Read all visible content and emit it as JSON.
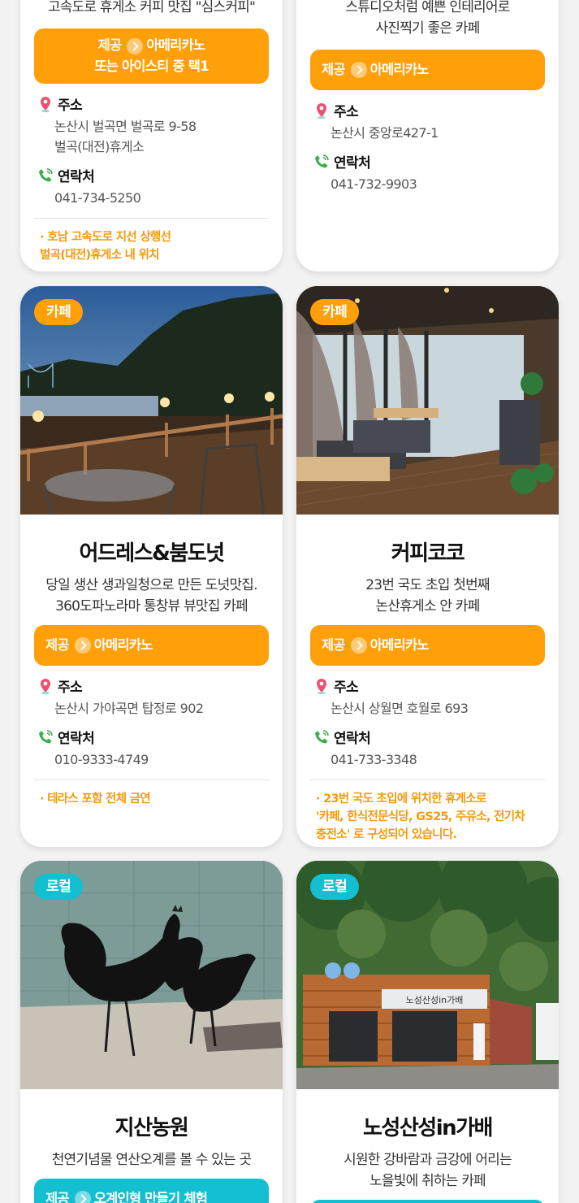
{
  "cards": {
    "c1": {
      "desc_lines": [
        "고속도로 휴게소 커피 맛집 \"심스커피\""
      ],
      "offer_label": "제공",
      "offer_line1": "아메리카노",
      "offer_line2": "또는 아이스티 중 택1",
      "address_label": "주소",
      "address_lines": [
        "논산시 벌곡면 벌곡로 9-58",
        "벌곡(대전)휴게소"
      ],
      "contact_label": "연락처",
      "phone": "041-734-5250",
      "note_lines": [
        "· 호남 고속도로 지선 상행선",
        "벌곡(대전)휴게소 내 위치"
      ]
    },
    "c2": {
      "desc_lines": [
        "스튜디오처럼 예쁜 인테리어로",
        "사진찍기 좋은 카페"
      ],
      "offer_label": "제공",
      "offer": "아메리카노",
      "address_label": "주소",
      "address": "논산시 중앙로427-1",
      "contact_label": "연락처",
      "phone": "041-732-9903"
    },
    "c3": {
      "tag": "카페",
      "title": "어드레스&붐도넛",
      "desc_lines": [
        "당일 생산 생과일청으로 만든 도넛맛집.",
        "360도파노라마 통창뷰 뷰맛집 카페"
      ],
      "offer_label": "제공",
      "offer": "아메리카노",
      "address_label": "주소",
      "address": "논산시 가야곡면 탑정로 902",
      "contact_label": "연락처",
      "phone": "010-9333-4749",
      "note_lines": [
        "· 테라스 포함 전체 금연"
      ]
    },
    "c4": {
      "tag": "카페",
      "title": "커피코코",
      "desc_lines": [
        "23번 국도 초입 첫번째",
        "논산휴게소 안 카페"
      ],
      "offer_label": "제공",
      "offer": "아메리카노",
      "address_label": "주소",
      "address": "논산시 상월면 호월로 693",
      "contact_label": "연락처",
      "phone": "041-733-3348",
      "note_lines": [
        "· 23번 국도 초입에 위치한 휴게소로",
        "'카페, 한식전문식당, GS25, 주유소, 전기차",
        "충전소' 로 구성되어 있습니다."
      ]
    },
    "c5": {
      "tag": "로컬",
      "title": "지산농원",
      "desc_lines": [
        "천연기념물 연산오계를 볼 수 있는 곳"
      ],
      "offer_label": "제공",
      "offer": "오계인형 만들기 체험"
    },
    "c6": {
      "tag": "로컬",
      "title": "노성산성in가배",
      "desc_lines": [
        "시원한 강바람과 금강에 어리는",
        "노을빛에 취하는 카페"
      ],
      "sign_text": "노성산성in가배"
    }
  },
  "colors": {
    "accent_orange": "#ff9f0a",
    "accent_teal": "#13bfd0",
    "note_orange": "#f59a0c"
  },
  "icons": {
    "address": "map-pin-icon",
    "contact": "phone-icon",
    "offer": "chevron-right-icon"
  }
}
